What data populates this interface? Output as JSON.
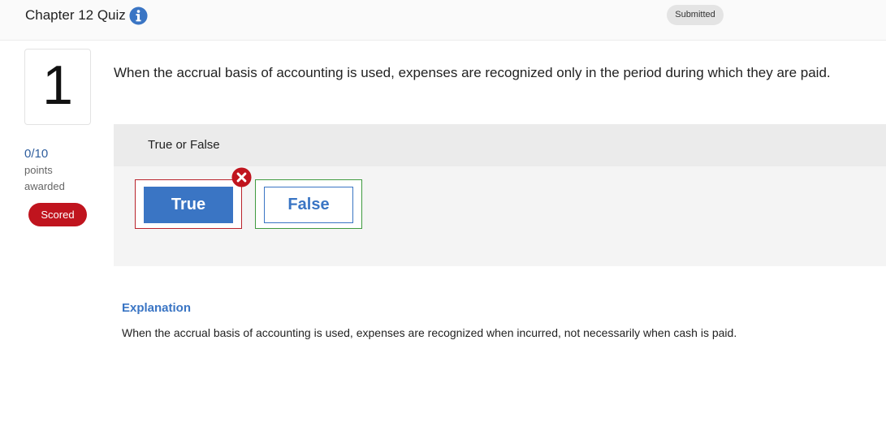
{
  "header": {
    "title": "Chapter 12 Quiz",
    "status": "Submitted"
  },
  "question": {
    "number": "1",
    "score": "0/10",
    "points_label": "points",
    "awarded_label": "awarded",
    "scored_badge": "Scored",
    "text": "When the accrual basis of accounting is used, expenses are recognized only in the period during which they are paid.",
    "answer_type": "True or False",
    "options": [
      {
        "label": "True",
        "state": "selected-incorrect"
      },
      {
        "label": "False",
        "state": "correct-answer"
      }
    ]
  },
  "explanation": {
    "title": "Explanation",
    "text": "When the accrual basis of accounting is used, expenses are recognized when incurred, not necessarily when cash is paid."
  },
  "colors": {
    "accent": "#3a75c4",
    "incorrect": "#c0141e",
    "correct": "#3f9a3f"
  },
  "icons": {
    "info": "info-icon",
    "incorrect": "close-circle-icon"
  }
}
